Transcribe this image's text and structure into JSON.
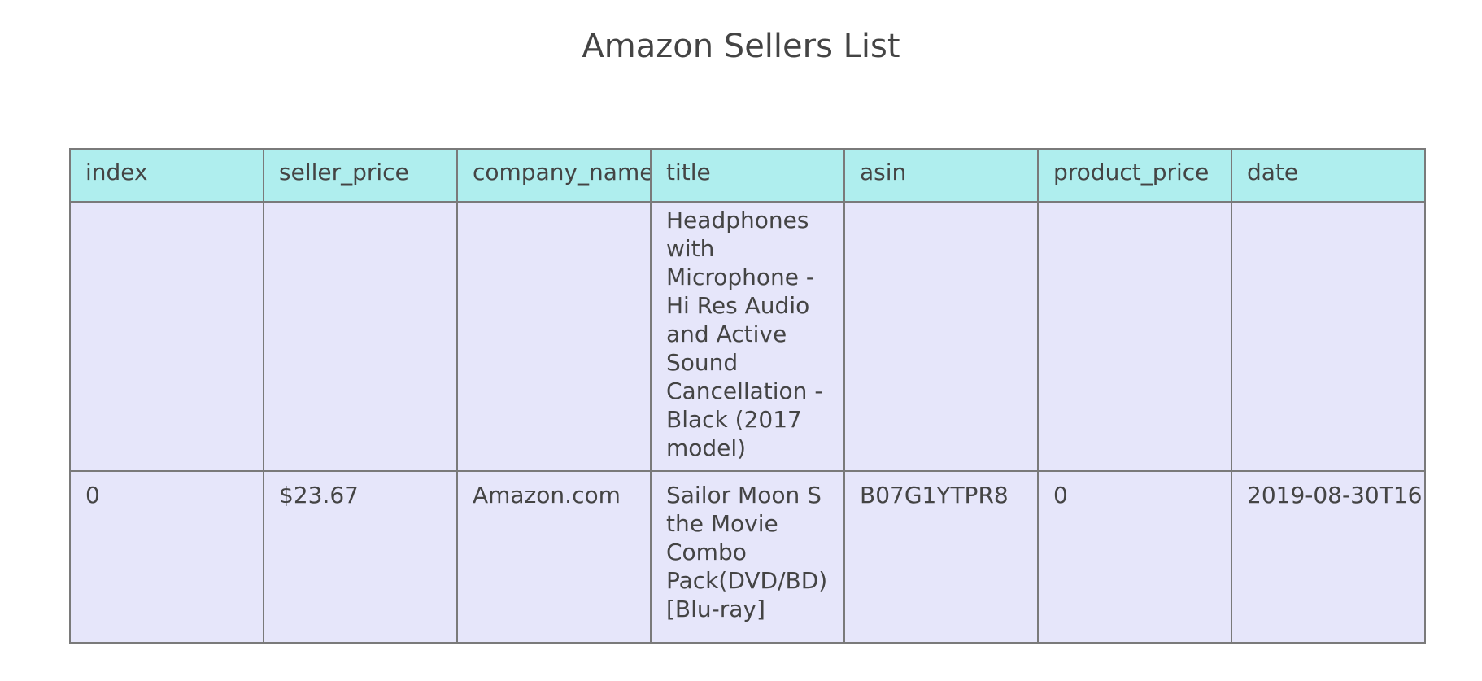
{
  "chart_data": {
    "type": "table",
    "title": "Amazon Sellers List",
    "columns": [
      "index",
      "seller_price",
      "company_name",
      "title",
      "asin",
      "product_price",
      "date"
    ],
    "rows": [
      {
        "index": "",
        "seller_price": "",
        "company_name": "",
        "title": "Headphones with Microphone - Hi Res Audio and Active Sound Cancellation - Black (2017 model)",
        "asin": "",
        "product_price": "",
        "date": ""
      },
      {
        "index": "0",
        "seller_price": "$23.67",
        "company_name": "Amazon.com",
        "title": "Sailor Moon S the Movie Combo Pack(DVD/BD) [Blu-ray]",
        "asin": "B07G1YTPR8",
        "product_price": "0",
        "date": "2019-08-30T16:"
      }
    ],
    "colors": {
      "header_fill": "#afeeee",
      "cell_fill": "#e6e6fa",
      "border": "#7a7a7a",
      "text": "#444444"
    }
  }
}
